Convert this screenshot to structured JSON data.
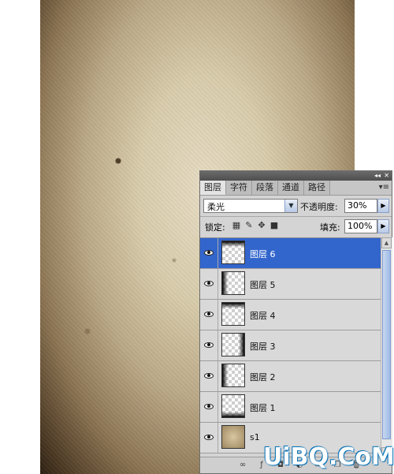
{
  "layers_panel": {
    "tabs": [
      "图层",
      "字符",
      "段落",
      "通道",
      "路径"
    ],
    "blend_mode": "柔光",
    "opacity_label": "不透明度:",
    "opacity_value": "30%",
    "lock_label": "锁定:",
    "fill_label": "填充:",
    "fill_value": "100%",
    "layers": [
      {
        "name": "图层 6",
        "selected": true
      },
      {
        "name": "图层 5",
        "selected": false
      },
      {
        "name": "图层 4",
        "selected": false
      },
      {
        "name": "图层 3",
        "selected": false
      },
      {
        "name": "图层 2",
        "selected": false
      },
      {
        "name": "图层 1",
        "selected": false
      },
      {
        "name": "s1",
        "selected": false
      }
    ]
  },
  "watermark": "UiBQ.CoM"
}
